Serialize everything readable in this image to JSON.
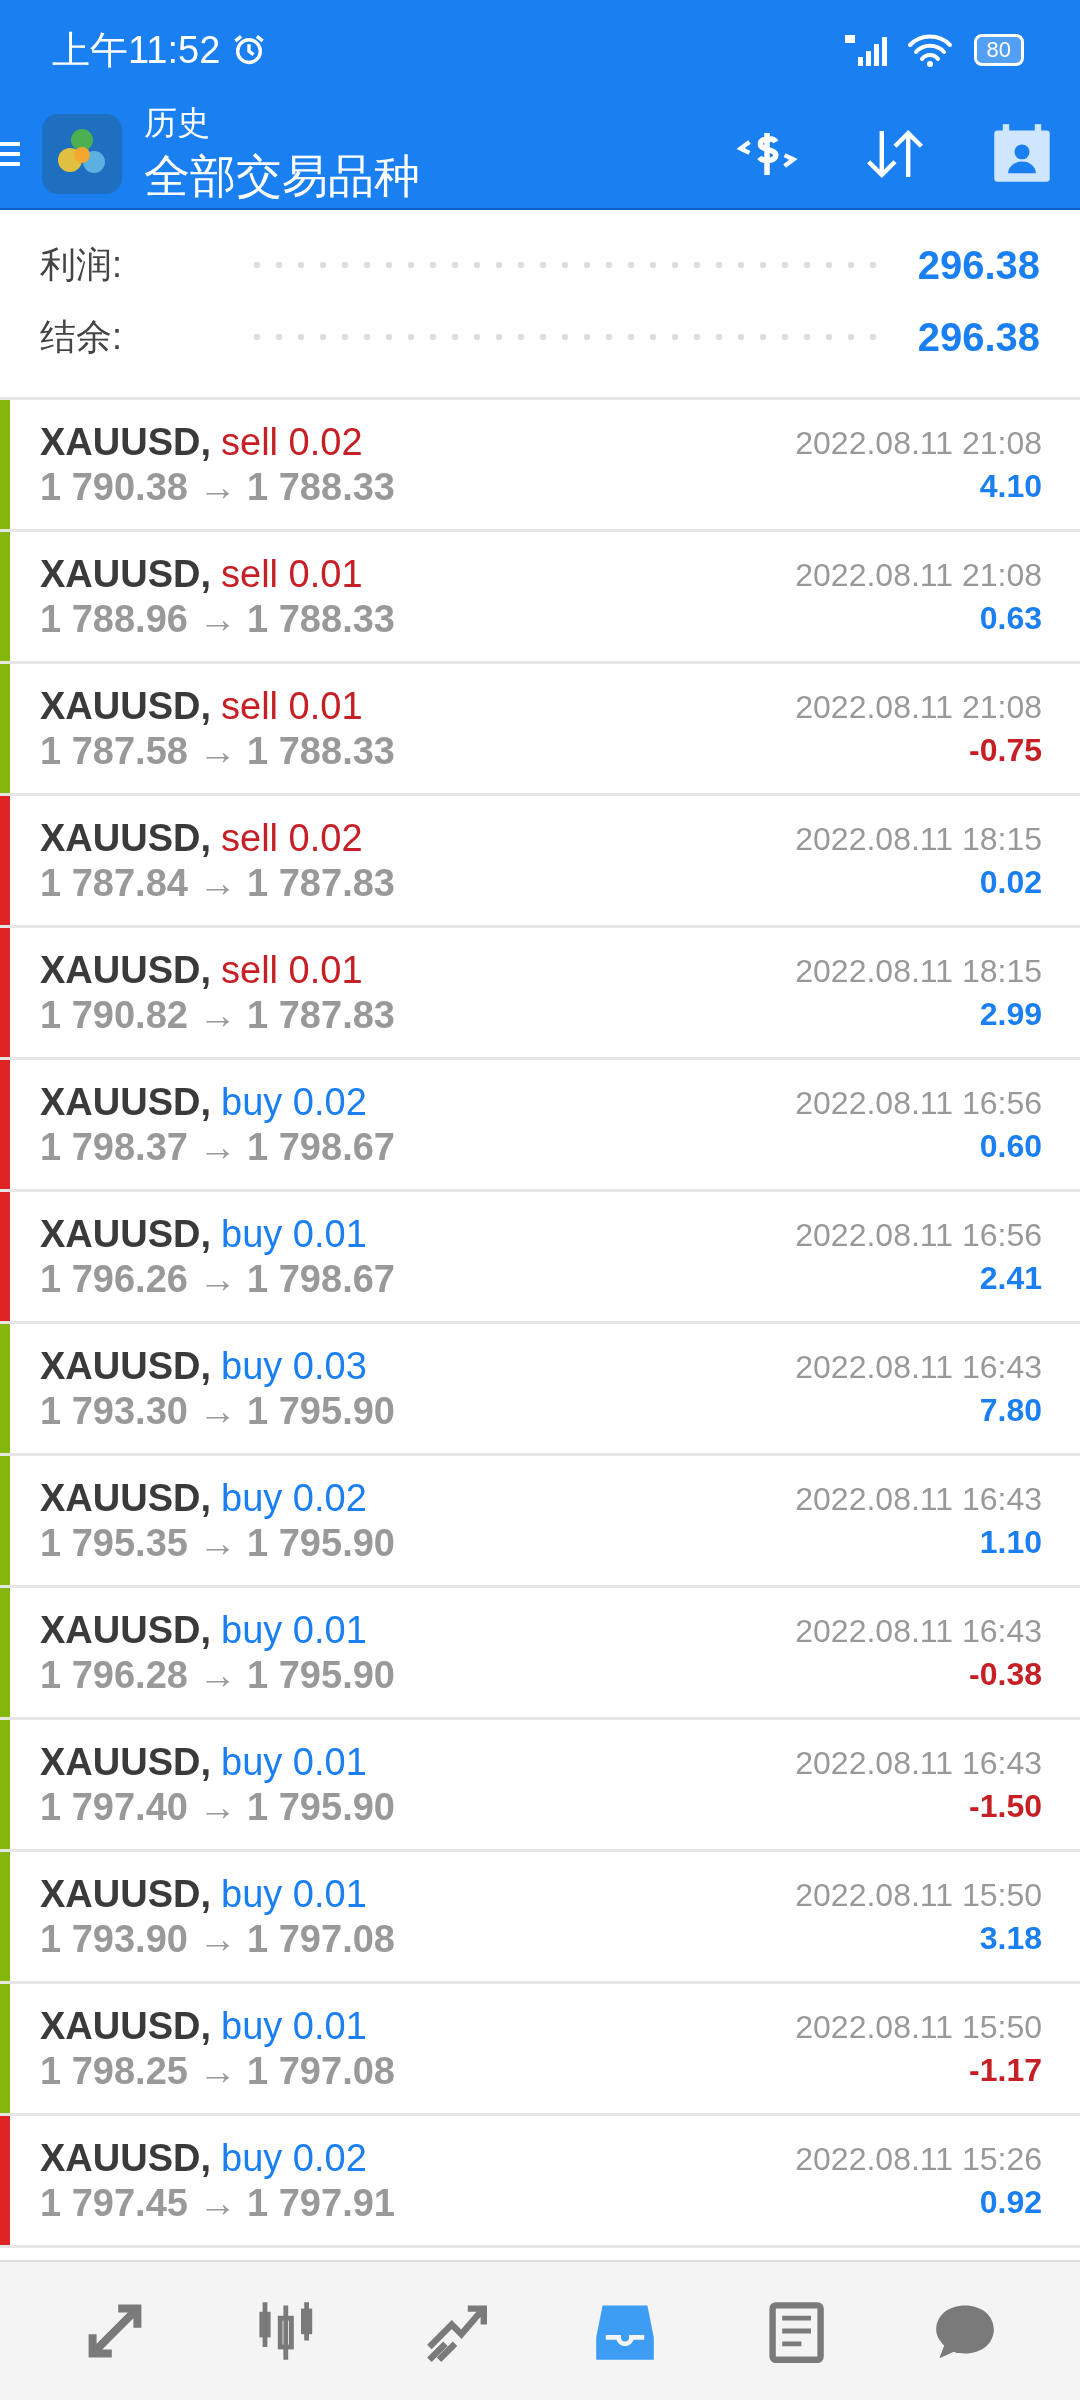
{
  "status_bar": {
    "time": "上午11:52",
    "battery": "80"
  },
  "toolbar": {
    "title": "历史",
    "subtitle": "全部交易品种"
  },
  "summary": [
    {
      "label": "利润:",
      "value": "296.38"
    },
    {
      "label": "结余:",
      "value": "296.38"
    }
  ],
  "deals": [
    {
      "symbol": "XAUUSD,",
      "side": "sell",
      "volume": "0.02",
      "prices": "1 790.38 → 1 788.33",
      "time": "2022.08.11 21:08",
      "profit": "4.10",
      "negative": false,
      "color": "#86b60c"
    },
    {
      "symbol": "XAUUSD,",
      "side": "sell",
      "volume": "0.01",
      "prices": "1 788.96 → 1 788.33",
      "time": "2022.08.11 21:08",
      "profit": "0.63",
      "negative": false,
      "color": "#86b60c"
    },
    {
      "symbol": "XAUUSD,",
      "side": "sell",
      "volume": "0.01",
      "prices": "1 787.58 → 1 788.33",
      "time": "2022.08.11 21:08",
      "profit": "-0.75",
      "negative": true,
      "color": "#86b60c"
    },
    {
      "symbol": "XAUUSD,",
      "side": "sell",
      "volume": "0.02",
      "prices": "1 787.84 → 1 787.83",
      "time": "2022.08.11 18:15",
      "profit": "0.02",
      "negative": false,
      "color": "#e02424"
    },
    {
      "symbol": "XAUUSD,",
      "side": "sell",
      "volume": "0.01",
      "prices": "1 790.82 → 1 787.83",
      "time": "2022.08.11 18:15",
      "profit": "2.99",
      "negative": false,
      "color": "#e02424"
    },
    {
      "symbol": "XAUUSD,",
      "side": "buy",
      "volume": "0.02",
      "prices": "1 798.37 → 1 798.67",
      "time": "2022.08.11 16:56",
      "profit": "0.60",
      "negative": false,
      "color": "#e02424"
    },
    {
      "symbol": "XAUUSD,",
      "side": "buy",
      "volume": "0.01",
      "prices": "1 796.26 → 1 798.67",
      "time": "2022.08.11 16:56",
      "profit": "2.41",
      "negative": false,
      "color": "#e02424"
    },
    {
      "symbol": "XAUUSD,",
      "side": "buy",
      "volume": "0.03",
      "prices": "1 793.30 → 1 795.90",
      "time": "2022.08.11 16:43",
      "profit": "7.80",
      "negative": false,
      "color": "#86b60c"
    },
    {
      "symbol": "XAUUSD,",
      "side": "buy",
      "volume": "0.02",
      "prices": "1 795.35 → 1 795.90",
      "time": "2022.08.11 16:43",
      "profit": "1.10",
      "negative": false,
      "color": "#86b60c"
    },
    {
      "symbol": "XAUUSD,",
      "side": "buy",
      "volume": "0.01",
      "prices": "1 796.28 → 1 795.90",
      "time": "2022.08.11 16:43",
      "profit": "-0.38",
      "negative": true,
      "color": "#86b60c"
    },
    {
      "symbol": "XAUUSD,",
      "side": "buy",
      "volume": "0.01",
      "prices": "1 797.40 → 1 795.90",
      "time": "2022.08.11 16:43",
      "profit": "-1.50",
      "negative": true,
      "color": "#86b60c"
    },
    {
      "symbol": "XAUUSD,",
      "side": "buy",
      "volume": "0.01",
      "prices": "1 793.90 → 1 797.08",
      "time": "2022.08.11 15:50",
      "profit": "3.18",
      "negative": false,
      "color": "#86b60c"
    },
    {
      "symbol": "XAUUSD,",
      "side": "buy",
      "volume": "0.01",
      "prices": "1 798.25 → 1 797.08",
      "time": "2022.08.11 15:50",
      "profit": "-1.17",
      "negative": true,
      "color": "#86b60c"
    },
    {
      "symbol": "XAUUSD,",
      "side": "buy",
      "volume": "0.02",
      "prices": "1 797.45 → 1 797.91",
      "time": "2022.08.11 15:26",
      "profit": "0.92",
      "negative": false,
      "color": "#e02424"
    }
  ],
  "bottom_nav": [
    {
      "kind": "quotes",
      "selected": false
    },
    {
      "kind": "chart",
      "selected": false
    },
    {
      "kind": "trade",
      "selected": false
    },
    {
      "kind": "history",
      "selected": true
    },
    {
      "kind": "news",
      "selected": false
    },
    {
      "kind": "chat",
      "selected": false
    }
  ]
}
